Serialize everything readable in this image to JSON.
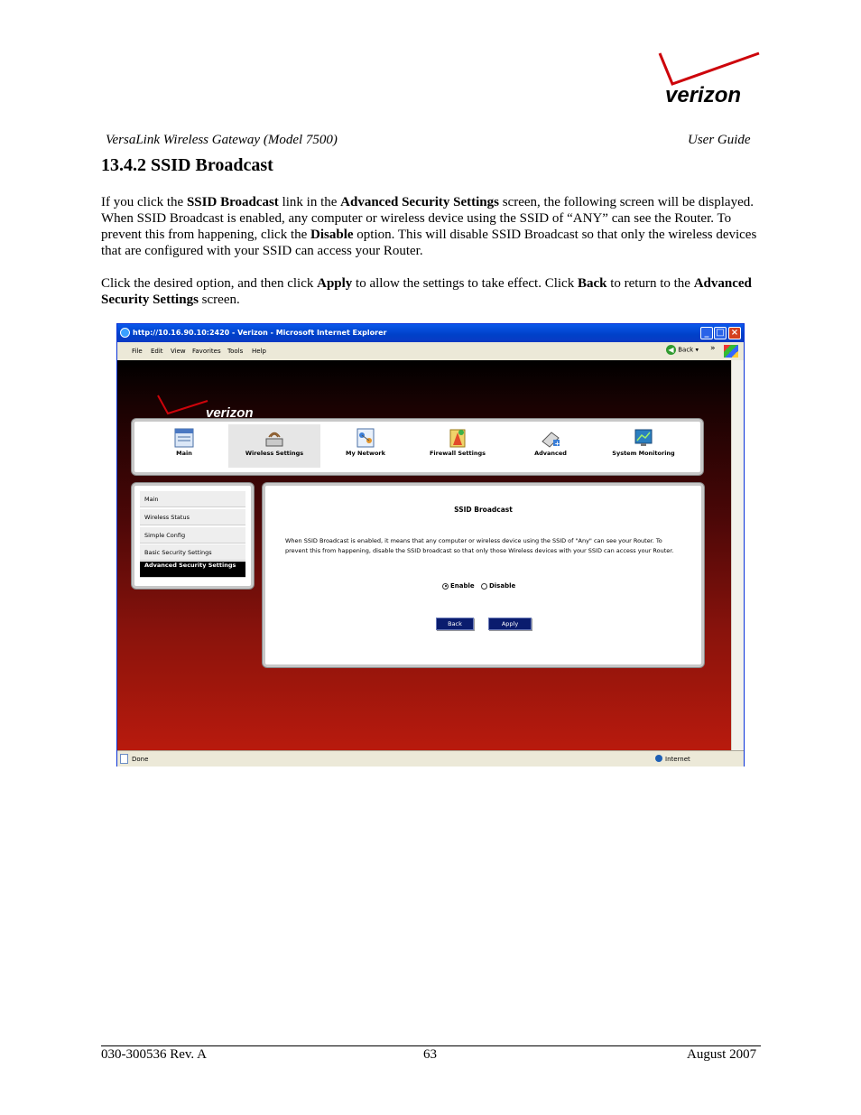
{
  "brand": {
    "logo_text": "verizon"
  },
  "doc_header": {
    "left": "VersaLink Wireless Gateway (Model 7500)",
    "right": "User Guide"
  },
  "section": {
    "title": "13.4.2 SSID Broadcast"
  },
  "paragraph1": {
    "t1": "If you click the ",
    "b1": "SSID Broadcast",
    "t2": " link in the ",
    "b2": "Advanced Security Settings",
    "t3": " screen, the following screen will be displayed. When SSID Broadcast is enabled, any computer or wireless device using the SSID of “ANY” can see the Router. To prevent this from happening, click the ",
    "b3": "Disable",
    "t4": " option. This will disable SSID Broadcast so that only the wireless devices that are configured with your SSID can access your Router."
  },
  "paragraph2": {
    "t1": "Click the desired option, and then click ",
    "b1": "Apply",
    "t2": " to allow the settings to take effect. Click ",
    "b2": "Back",
    "t3": " to return to the ",
    "b3": "Advanced Security Settings",
    "t4": " screen."
  },
  "browser": {
    "title": "http://10.16.90.10:2420 - Verizon - Microsoft Internet Explorer",
    "menu": [
      "File",
      "Edit",
      "View",
      "Favorites",
      "Tools",
      "Help"
    ],
    "back_label": "Back",
    "chevron": "»",
    "status": "Done",
    "zone": "Internet"
  },
  "app": {
    "logo_text": "verizon",
    "nav": [
      {
        "label": "Main",
        "icon": "main-icon"
      },
      {
        "label": "Wireless Settings",
        "icon": "wireless-settings-icon",
        "active": true
      },
      {
        "label": "My Network",
        "icon": "my-network-icon"
      },
      {
        "label": "Firewall Settings",
        "icon": "firewall-icon"
      },
      {
        "label": "Advanced",
        "icon": "advanced-icon"
      },
      {
        "label": "System Monitoring",
        "icon": "system-monitoring-icon"
      }
    ],
    "sidebar": [
      {
        "label": "Main"
      },
      {
        "label": "Wireless Status"
      },
      {
        "label": "Simple Config"
      },
      {
        "label": "Basic Security Settings"
      },
      {
        "label": "Advanced Security Settings",
        "active": true
      }
    ],
    "content": {
      "title": "SSID Broadcast",
      "text": "When SSID Broadcast is enabled, it means that any computer or wireless device using the SSID of \"Any\" can see your Router. To prevent this from happening, disable the SSID broadcast so that only those Wireless devices with your SSID can access your Router.",
      "enable_label": "Enable",
      "disable_label": "Disable",
      "selected": "Enable",
      "back_button": "Back",
      "apply_button": "Apply"
    }
  },
  "footer": {
    "left": "030-300536 Rev. A",
    "center": "63",
    "right": "August 2007"
  },
  "colors": {
    "verizon_red": "#cd040b",
    "app_bg_top": "#000000",
    "app_bg_bottom": "#b81a0d",
    "button_navy": "#0a1c6e"
  }
}
